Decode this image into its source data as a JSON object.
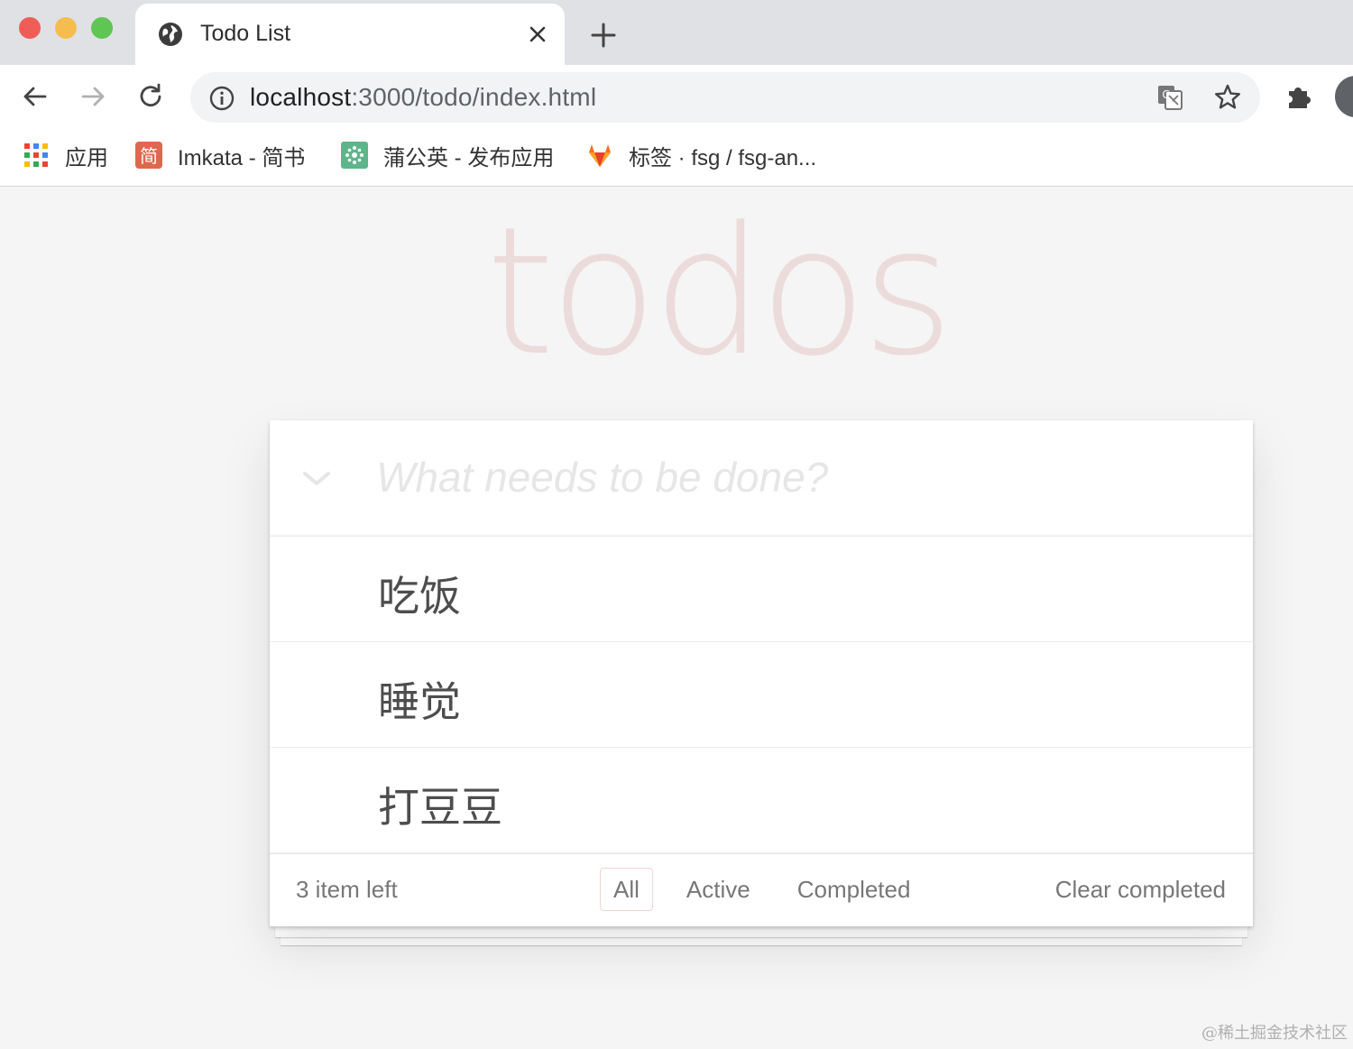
{
  "browser": {
    "tab": {
      "title": "Todo List"
    },
    "address_bar": {
      "host": "localhost",
      "rest": ":3000/todo/index.html"
    },
    "bookmarks": [
      {
        "label": "应用",
        "icon": "apps-grid-icon"
      },
      {
        "label": "Imkata - 简书",
        "icon": "jianshu-icon",
        "icon_text": "简"
      },
      {
        "label": "蒲公英 - 发布应用",
        "icon": "pgyer-icon"
      },
      {
        "label": "标签 · fsg / fsg-an...",
        "icon": "gitlab-icon"
      }
    ]
  },
  "app": {
    "title": "todos",
    "new_todo_placeholder": "What needs to be done?",
    "todos": [
      {
        "label": "吃饭"
      },
      {
        "label": "睡觉"
      },
      {
        "label": "打豆豆"
      }
    ],
    "footer": {
      "count_text": "3 item left",
      "filters": [
        {
          "label": "All",
          "selected": true
        },
        {
          "label": "Active",
          "selected": false
        },
        {
          "label": "Completed",
          "selected": false
        }
      ],
      "clear_label": "Clear completed"
    },
    "accent_color": "#af2f2f"
  },
  "watermark": "@稀土掘金技术社区"
}
